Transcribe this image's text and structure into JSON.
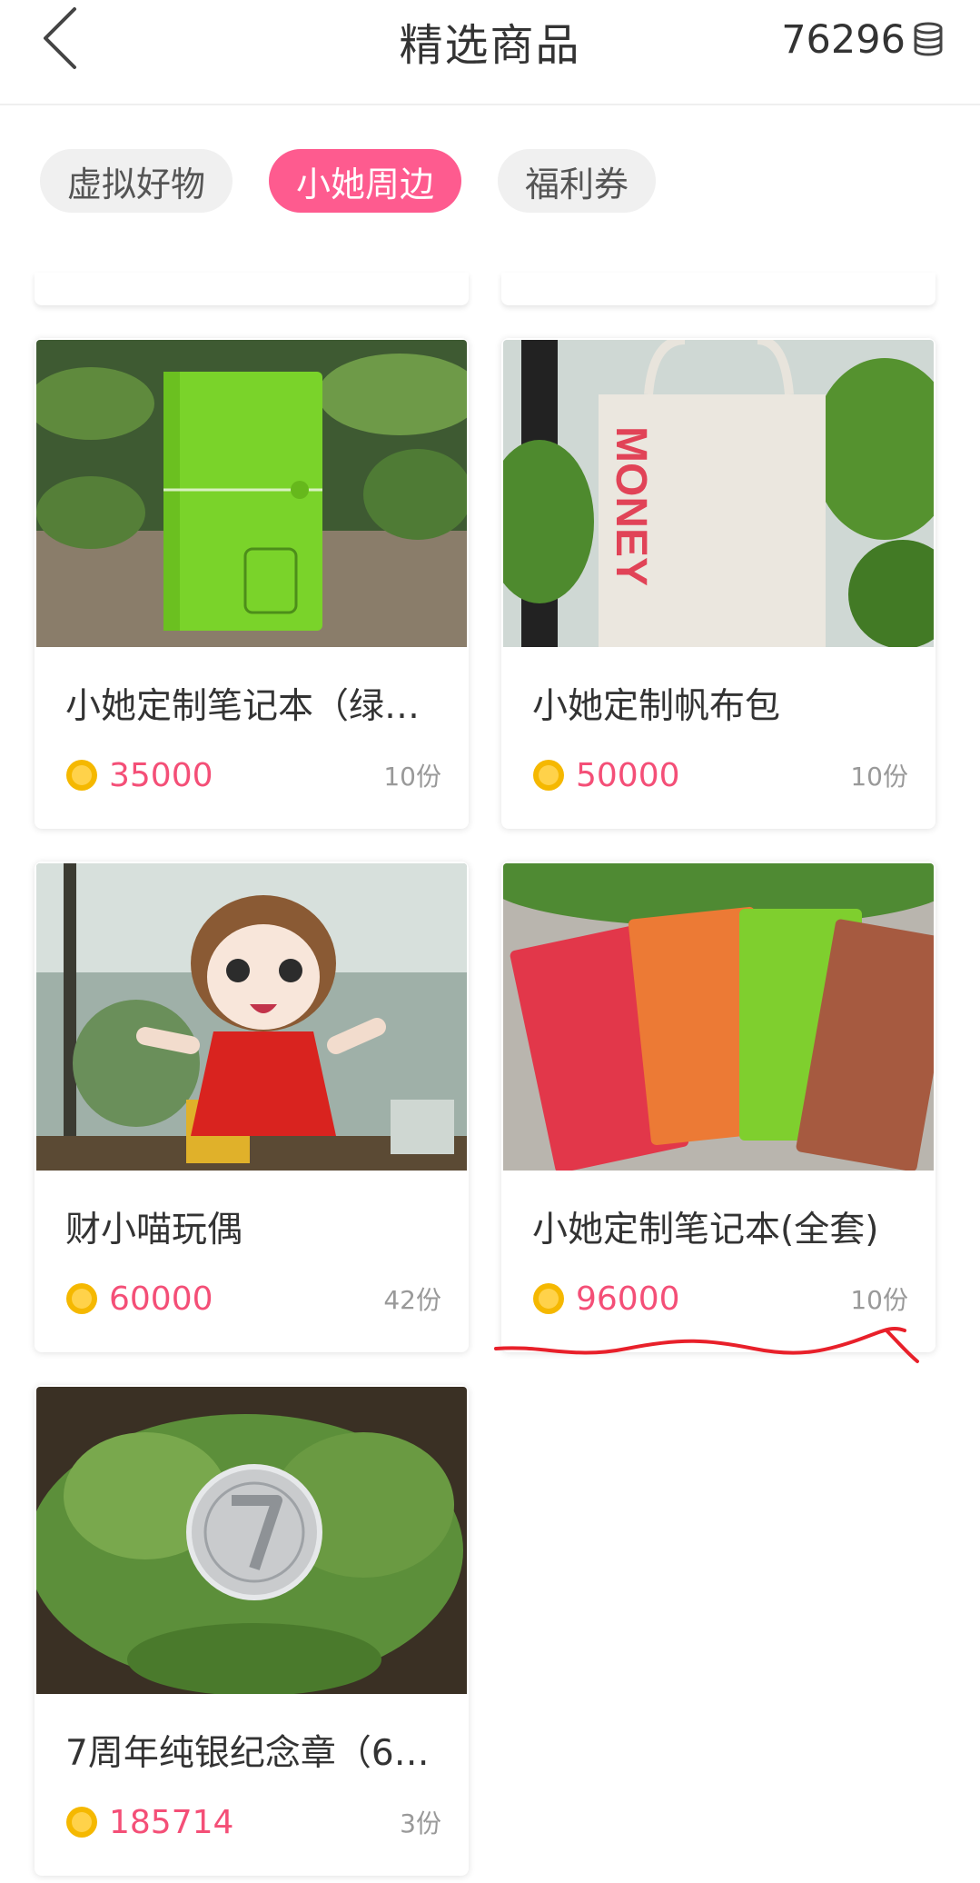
{
  "header": {
    "title": "精选商品",
    "coin_balance": "76296"
  },
  "tabs": [
    {
      "label": "虚拟好物",
      "active": false
    },
    {
      "label": "小她周边",
      "active": true
    },
    {
      "label": "福利券",
      "active": false
    }
  ],
  "products": [
    {
      "name": "小她定制笔记本（绿…",
      "price": "35000",
      "quantity": "10份"
    },
    {
      "name": "小她定制帆布包",
      "price": "50000",
      "quantity": "10份"
    },
    {
      "name": "财小喵玩偶",
      "price": "60000",
      "quantity": "42份"
    },
    {
      "name": "小她定制笔记本(全套)",
      "price": "96000",
      "quantity": "10份"
    },
    {
      "name": "7周年纯银纪念章（6…",
      "price": "185714",
      "quantity": "3份"
    }
  ],
  "bag_text": "MONEY",
  "colors": {
    "accent": "#fe5b8f",
    "price": "#f44f77",
    "annotation": "#e8202a"
  }
}
